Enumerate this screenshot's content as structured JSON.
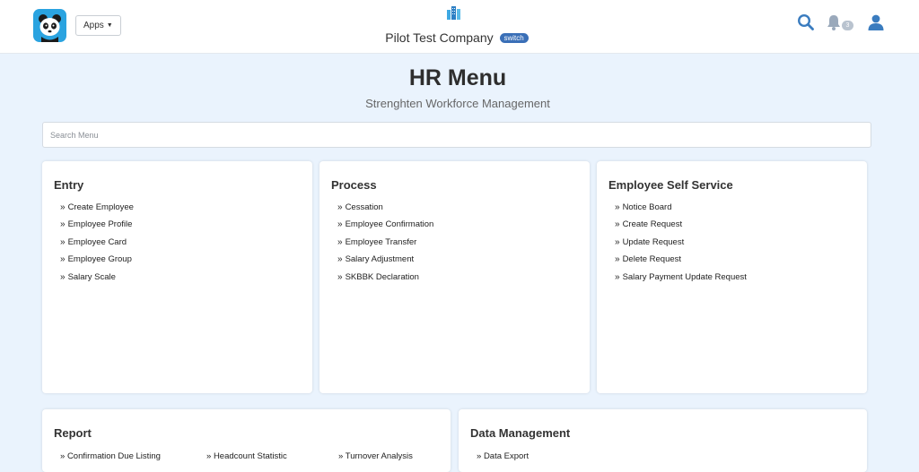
{
  "topbar": {
    "apps_label": "Apps",
    "company_name": "Pilot Test Company",
    "switch_label": "switch",
    "notification_count": "3",
    "icons": {
      "logo": "panda-logo-icon",
      "company": "buildings-icon",
      "search": "search-icon",
      "bell": "bell-icon",
      "user": "user-icon"
    }
  },
  "header": {
    "title": "HR Menu",
    "subtitle": "Strenghten Workforce Management"
  },
  "search": {
    "placeholder": "Search Menu"
  },
  "cards": {
    "entry": {
      "title": "Entry",
      "items": [
        "Create Employee",
        "Employee Profile",
        "Employee Card",
        "Employee Group",
        "Salary Scale"
      ]
    },
    "process": {
      "title": "Process",
      "items": [
        "Cessation",
        "Employee Confirmation",
        "Employee Transfer",
        "Salary Adjustment",
        "SKBBK Declaration"
      ]
    },
    "ess": {
      "title": "Employee Self Service",
      "items": [
        "Notice Board",
        "Create Request",
        "Update Request",
        "Delete Request",
        "Salary Payment Update Request"
      ]
    },
    "report": {
      "title": "Report",
      "items": [
        "Confirmation Due Listing",
        "Headcount Statistic",
        "Turnover Analysis"
      ]
    },
    "data_management": {
      "title": "Data Management",
      "items": [
        "Data Export"
      ]
    }
  },
  "colors": {
    "background": "#eaf3fd",
    "accent": "#3a6fb7",
    "icon_blue": "#3a7cbf",
    "logo_blue": "#2aa3e0"
  }
}
